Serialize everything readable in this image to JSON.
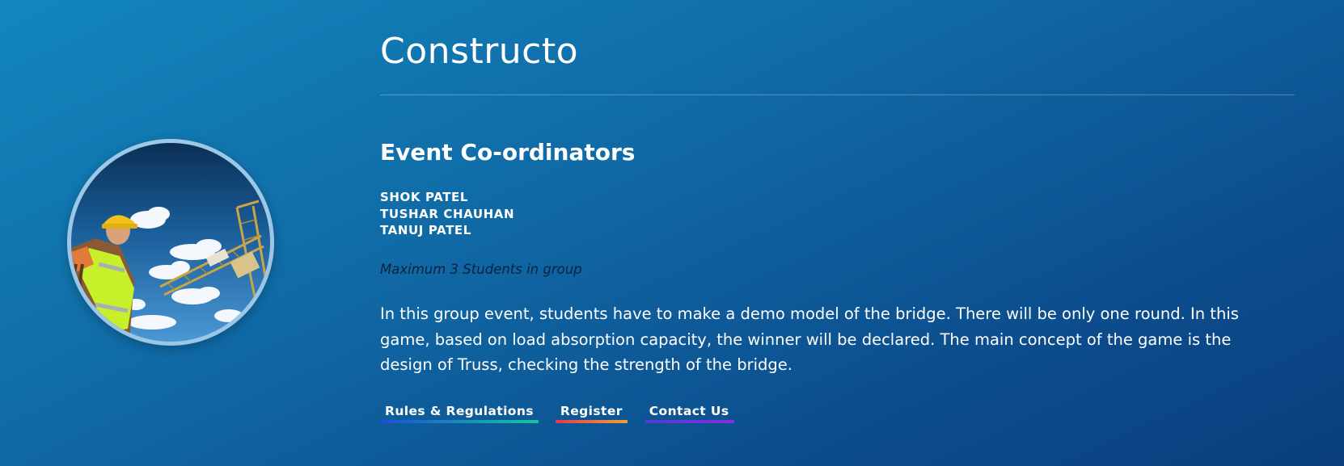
{
  "event": {
    "title": "Constructo",
    "coordinators_heading": "Event Co-ordinators",
    "coordinators": [
      "SHOK PATEL",
      "TUSHAR CHAUHAN",
      "TANUJ PATEL"
    ],
    "group_note": "Maximum 3 Students in group",
    "description": "In this group event, students have to make a demo model of the bridge. There will be only one round. In this game, based on load absorption capacity, the winner will be declared. The main concept of the game is the design of Truss, checking the strength of the bridge."
  },
  "links": {
    "rules": "Rules & Regulations",
    "register": "Register",
    "contact": "Contact Us"
  },
  "colors": {
    "background_start": "#1386bd",
    "background_end": "#0a3e7e",
    "rules_bar": [
      "#1d4fd8",
      "#14c7a0"
    ],
    "register_bar": [
      "#e8384d",
      "#f0a236"
    ],
    "contact_bar": [
      "#4b3fd0",
      "#8a2be2"
    ]
  },
  "image": {
    "icon": "construction-worker-crane-photo"
  }
}
